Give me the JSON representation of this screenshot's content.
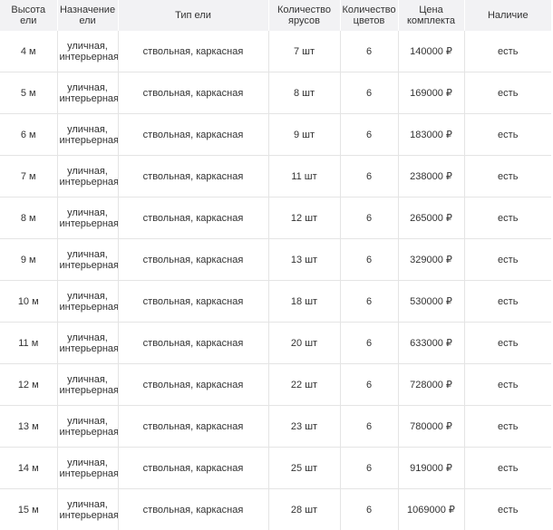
{
  "table": {
    "headers": {
      "height": "Высота ели",
      "purpose": "Назначение ели",
      "type": "Тип ели",
      "tiers": "Количество ярусов",
      "colors": "Количество цветов",
      "price": "Цена комплекта",
      "availability": "Наличие"
    },
    "rows": [
      {
        "height": "4 м",
        "purpose": "уличная, интерьерная",
        "type": "ствольная, каркасная",
        "tiers": "7 шт",
        "colors": "6",
        "price": "140000 ₽",
        "availability": "есть"
      },
      {
        "height": "5 м",
        "purpose": "уличная, интерьерная",
        "type": "ствольная, каркасная",
        "tiers": "8 шт",
        "colors": "6",
        "price": "169000 ₽",
        "availability": "есть"
      },
      {
        "height": "6 м",
        "purpose": "уличная, интерьерная",
        "type": "ствольная, каркасная",
        "tiers": "9 шт",
        "colors": "6",
        "price": "183000 ₽",
        "availability": "есть"
      },
      {
        "height": "7 м",
        "purpose": "уличная, интерьерная",
        "type": "ствольная, каркасная",
        "tiers": "11 шт",
        "colors": "6",
        "price": "238000 ₽",
        "availability": "есть"
      },
      {
        "height": "8 м",
        "purpose": "уличная, интерьерная",
        "type": "ствольная, каркасная",
        "tiers": "12 шт",
        "colors": "6",
        "price": "265000 ₽",
        "availability": "есть"
      },
      {
        "height": "9 м",
        "purpose": "уличная, интерьерная",
        "type": "ствольная, каркасная",
        "tiers": "13 шт",
        "colors": "6",
        "price": "329000 ₽",
        "availability": "есть"
      },
      {
        "height": "10 м",
        "purpose": "уличная, интерьерная",
        "type": "ствольная, каркасная",
        "tiers": "18 шт",
        "colors": "6",
        "price": "530000 ₽",
        "availability": "есть"
      },
      {
        "height": "11 м",
        "purpose": "уличная, интерьерная",
        "type": "ствольная, каркасная",
        "tiers": "20 шт",
        "colors": "6",
        "price": "633000 ₽",
        "availability": "есть"
      },
      {
        "height": "12 м",
        "purpose": "уличная, интерьерная",
        "type": "ствольная, каркасная",
        "tiers": "22 шт",
        "colors": "6",
        "price": "728000 ₽",
        "availability": "есть"
      },
      {
        "height": "13 м",
        "purpose": "уличная, интерьерная",
        "type": "ствольная, каркасная",
        "tiers": "23 шт",
        "colors": "6",
        "price": "780000 ₽",
        "availability": "есть"
      },
      {
        "height": "14 м",
        "purpose": "уличная, интерьерная",
        "type": "ствольная, каркасная",
        "tiers": "25 шт",
        "colors": "6",
        "price": "919000 ₽",
        "availability": "есть"
      },
      {
        "height": "15 м",
        "purpose": "уличная, интерьерная",
        "type": "ствольная, каркасная",
        "tiers": "28 шт",
        "colors": "6",
        "price": "1069000 ₽",
        "availability": "есть"
      }
    ]
  },
  "colors": {
    "header_bg": "#f2f2f4",
    "border": "#e4e4e4",
    "text": "#333333"
  }
}
